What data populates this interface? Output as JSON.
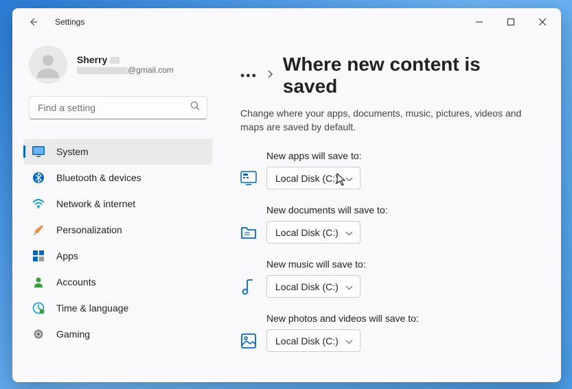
{
  "window": {
    "title": "Settings"
  },
  "user": {
    "name": "Sherry",
    "email_suffix": "@gmail.com"
  },
  "search": {
    "placeholder": "Find a setting"
  },
  "nav": {
    "items": [
      {
        "label": "System"
      },
      {
        "label": "Bluetooth & devices"
      },
      {
        "label": "Network & internet"
      },
      {
        "label": "Personalization"
      },
      {
        "label": "Apps"
      },
      {
        "label": "Accounts"
      },
      {
        "label": "Time & language"
      },
      {
        "label": "Gaming"
      }
    ]
  },
  "breadcrumb": {
    "dots": "•••",
    "title": "Where new content is saved"
  },
  "description": "Change where your apps, documents, music, pictures, videos and maps are saved by default.",
  "settings": [
    {
      "label": "New apps will save to:",
      "value": "Local Disk (C:)"
    },
    {
      "label": "New documents will save to:",
      "value": "Local Disk (C:)"
    },
    {
      "label": "New music will save to:",
      "value": "Local Disk (C:)"
    },
    {
      "label": "New photos and videos will save to:",
      "value": "Local Disk (C:)"
    }
  ]
}
